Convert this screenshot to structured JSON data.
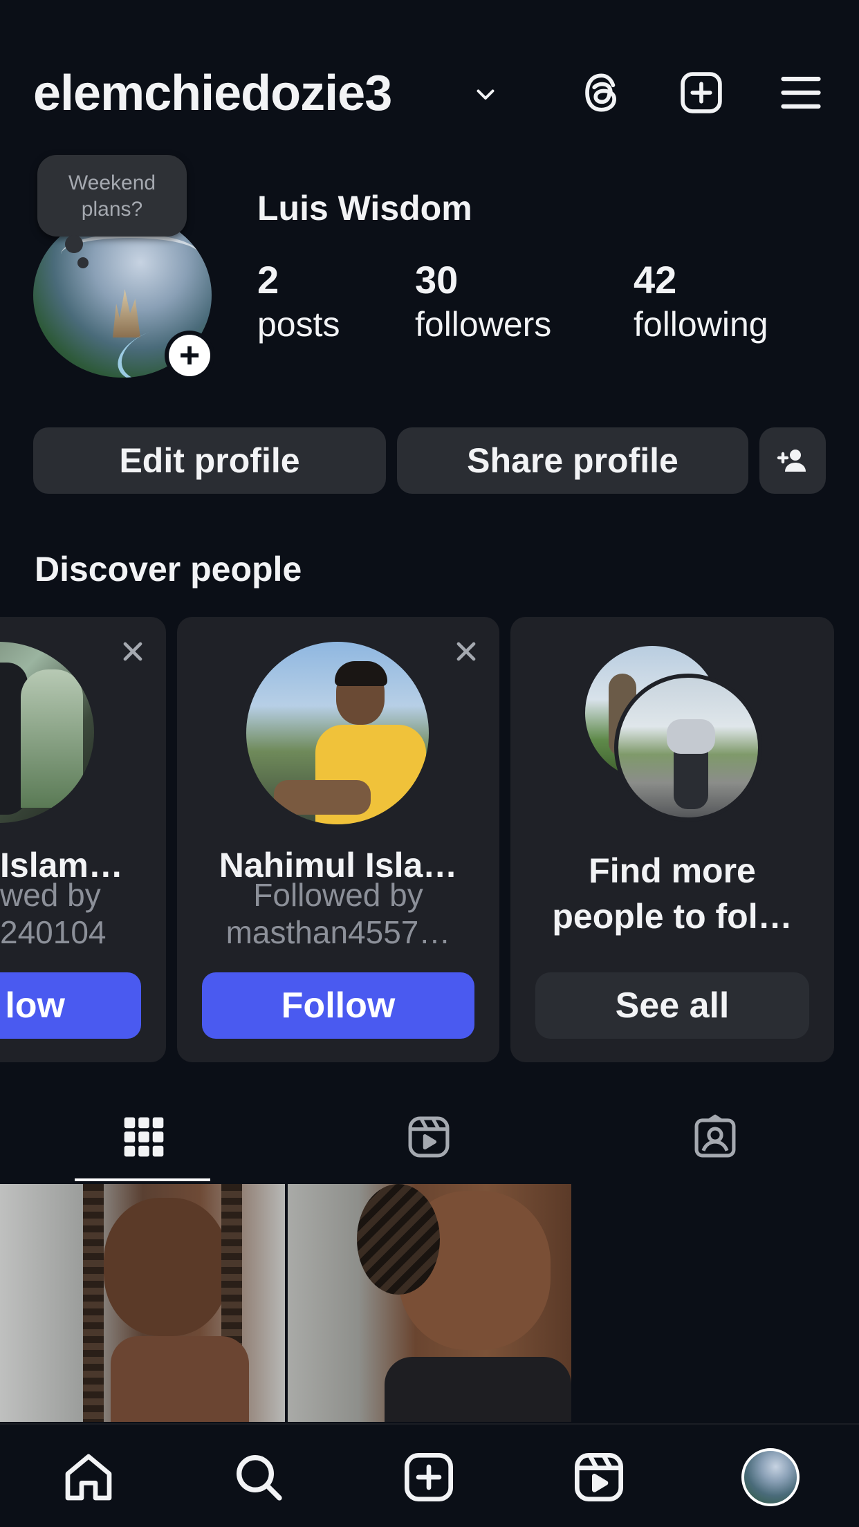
{
  "header": {
    "username": "elemchiedozie3",
    "icons": [
      "chevron-down-icon",
      "threads-icon",
      "add-post-icon",
      "menu-icon"
    ]
  },
  "profile": {
    "note": [
      "Weekend",
      "plans?"
    ],
    "full_name": "Luis Wisdom",
    "stats": [
      {
        "value": "2",
        "label": "posts"
      },
      {
        "value": "30",
        "label": "followers"
      },
      {
        "value": "42",
        "label": "following"
      }
    ]
  },
  "actions": {
    "edit_profile": "Edit profile",
    "share_profile": "Share profile"
  },
  "discover": {
    "title": "Discover people",
    "cards": [
      {
        "name": "Islam…",
        "sub1": "wed by",
        "sub2": "240104",
        "button": "low"
      },
      {
        "name": "Nahimul Isla…",
        "sub1": "Followed by",
        "sub2": "masthan4557…",
        "button": "Follow"
      },
      {
        "name1": "Find more",
        "name2": "people to fol…",
        "button": "See all"
      }
    ]
  },
  "tabs": [
    "grid-icon",
    "reels-icon",
    "tagged-icon"
  ],
  "nav": [
    "home-icon",
    "search-icon",
    "create-icon",
    "reels-icon",
    "profile-avatar"
  ],
  "colors": {
    "background": "#0b0f17",
    "button": "#2a2d33",
    "card": "#1f2127",
    "follow": "#4a5af0",
    "muted_text": "#8c9099"
  }
}
